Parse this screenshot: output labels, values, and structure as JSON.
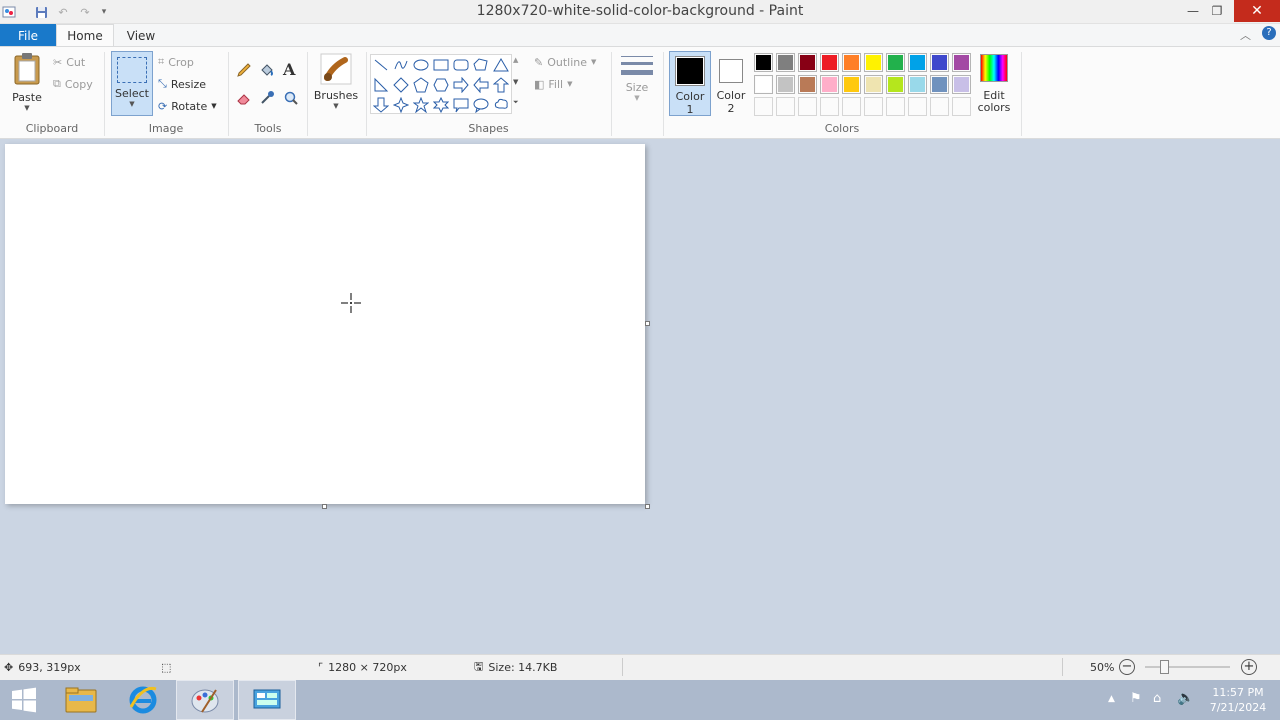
{
  "window": {
    "title": "1280x720-white-solid-color-background - Paint"
  },
  "menu": {
    "file": "File",
    "home": "Home",
    "view": "View"
  },
  "clipboard": {
    "paste": "Paste",
    "cut": "Cut",
    "copy": "Copy",
    "label": "Clipboard"
  },
  "image": {
    "select": "Select",
    "crop": "Crop",
    "resize": "Resize",
    "rotate": "Rotate",
    "label": "Image"
  },
  "tools": {
    "label": "Tools"
  },
  "brushes": {
    "label": "Brushes"
  },
  "shapes": {
    "outline": "Outline",
    "fill": "Fill",
    "label": "Shapes"
  },
  "size": {
    "label": "Size"
  },
  "colors": {
    "color1": "Color",
    "color1_num": "1",
    "color2": "Color",
    "color2_num": "2",
    "edit": "Edit",
    "edit2": "colors",
    "label": "Colors",
    "color1_value": "#000000",
    "color2_value": "#ffffff",
    "palette_row1": [
      "#000000",
      "#7f7f7f",
      "#880015",
      "#ed1c24",
      "#ff7f27",
      "#fff200",
      "#22b14c",
      "#00a2e8",
      "#3f48cc",
      "#a349a4"
    ],
    "palette_row2": [
      "#ffffff",
      "#c3c3c3",
      "#b97a57",
      "#ffaec9",
      "#ffc90e",
      "#efe4b0",
      "#b5e61d",
      "#99d9ea",
      "#7092be",
      "#c8bfe7"
    ]
  },
  "status": {
    "cursor": "693, 319px",
    "dimensions": "1280 × 720px",
    "size": "Size: 14.7KB",
    "zoom": "50%"
  },
  "taskbar": {
    "time": "11:57 PM",
    "date": "7/21/2024"
  }
}
